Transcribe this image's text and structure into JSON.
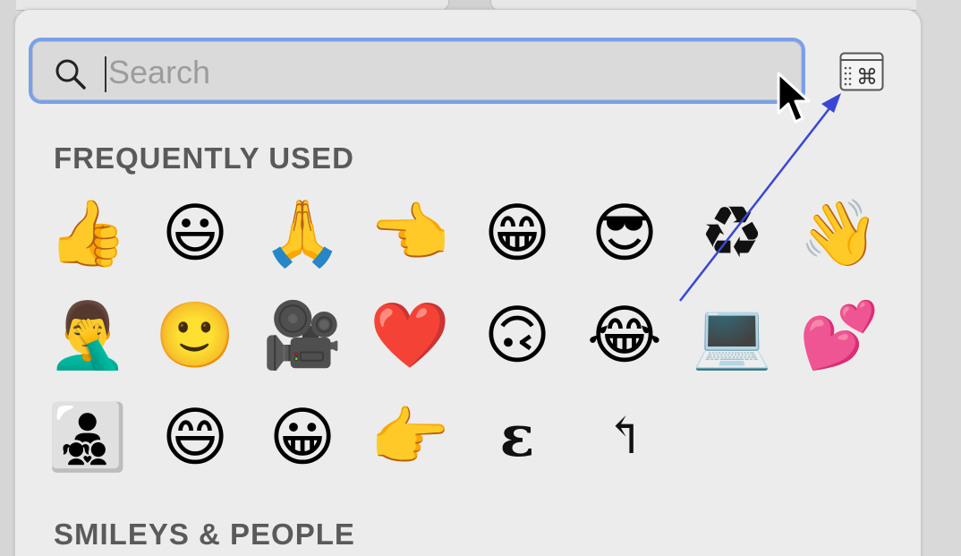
{
  "search": {
    "placeholder": "Search",
    "value": ""
  },
  "toolbar": {
    "character_viewer_icon": "command-grid-icon"
  },
  "sections": {
    "frequently_used": "FREQUENTLY USED",
    "smileys_people": "SMILEYS & PEOPLE"
  },
  "emojis": [
    {
      "char": "👍",
      "name": "thumbs-up"
    },
    {
      "char": "😃",
      "name": "grinning-big-eyes"
    },
    {
      "char": "🙏",
      "name": "folded-hands"
    },
    {
      "char": "👈",
      "name": "backhand-pointing-left"
    },
    {
      "char": "😁",
      "name": "beaming-face"
    },
    {
      "char": "😎",
      "name": "sunglasses-face"
    },
    {
      "char": "♻",
      "name": "recycling-symbol"
    },
    {
      "char": "👋",
      "name": "waving-hand"
    },
    {
      "char": "🤦‍♂️",
      "name": "man-facepalming"
    },
    {
      "char": "🙂",
      "name": "slightly-smiling-face"
    },
    {
      "char": "🎥",
      "name": "movie-camera"
    },
    {
      "char": "❤️",
      "name": "red-heart"
    },
    {
      "char": "🙃",
      "name": "upside-down-face"
    },
    {
      "char": "😂",
      "name": "tears-of-joy"
    },
    {
      "char": "💻",
      "name": "laptop"
    },
    {
      "char": "💕",
      "name": "two-hearts"
    },
    {
      "char": "👨‍👧‍👦",
      "name": "family"
    },
    {
      "char": "😄",
      "name": "grinning-smiling-eyes"
    },
    {
      "char": "😀",
      "name": "grinning-face"
    },
    {
      "char": "👉",
      "name": "backhand-pointing-right"
    },
    {
      "char": "ɛ",
      "name": "latin-open-e"
    },
    {
      "char": "↰",
      "name": "upwards-arrow-tip-left"
    }
  ],
  "colors": {
    "focus_ring": "#7aa0ea",
    "annotation_arrow": "#3a47d4",
    "section_text": "#5a5a5a"
  }
}
